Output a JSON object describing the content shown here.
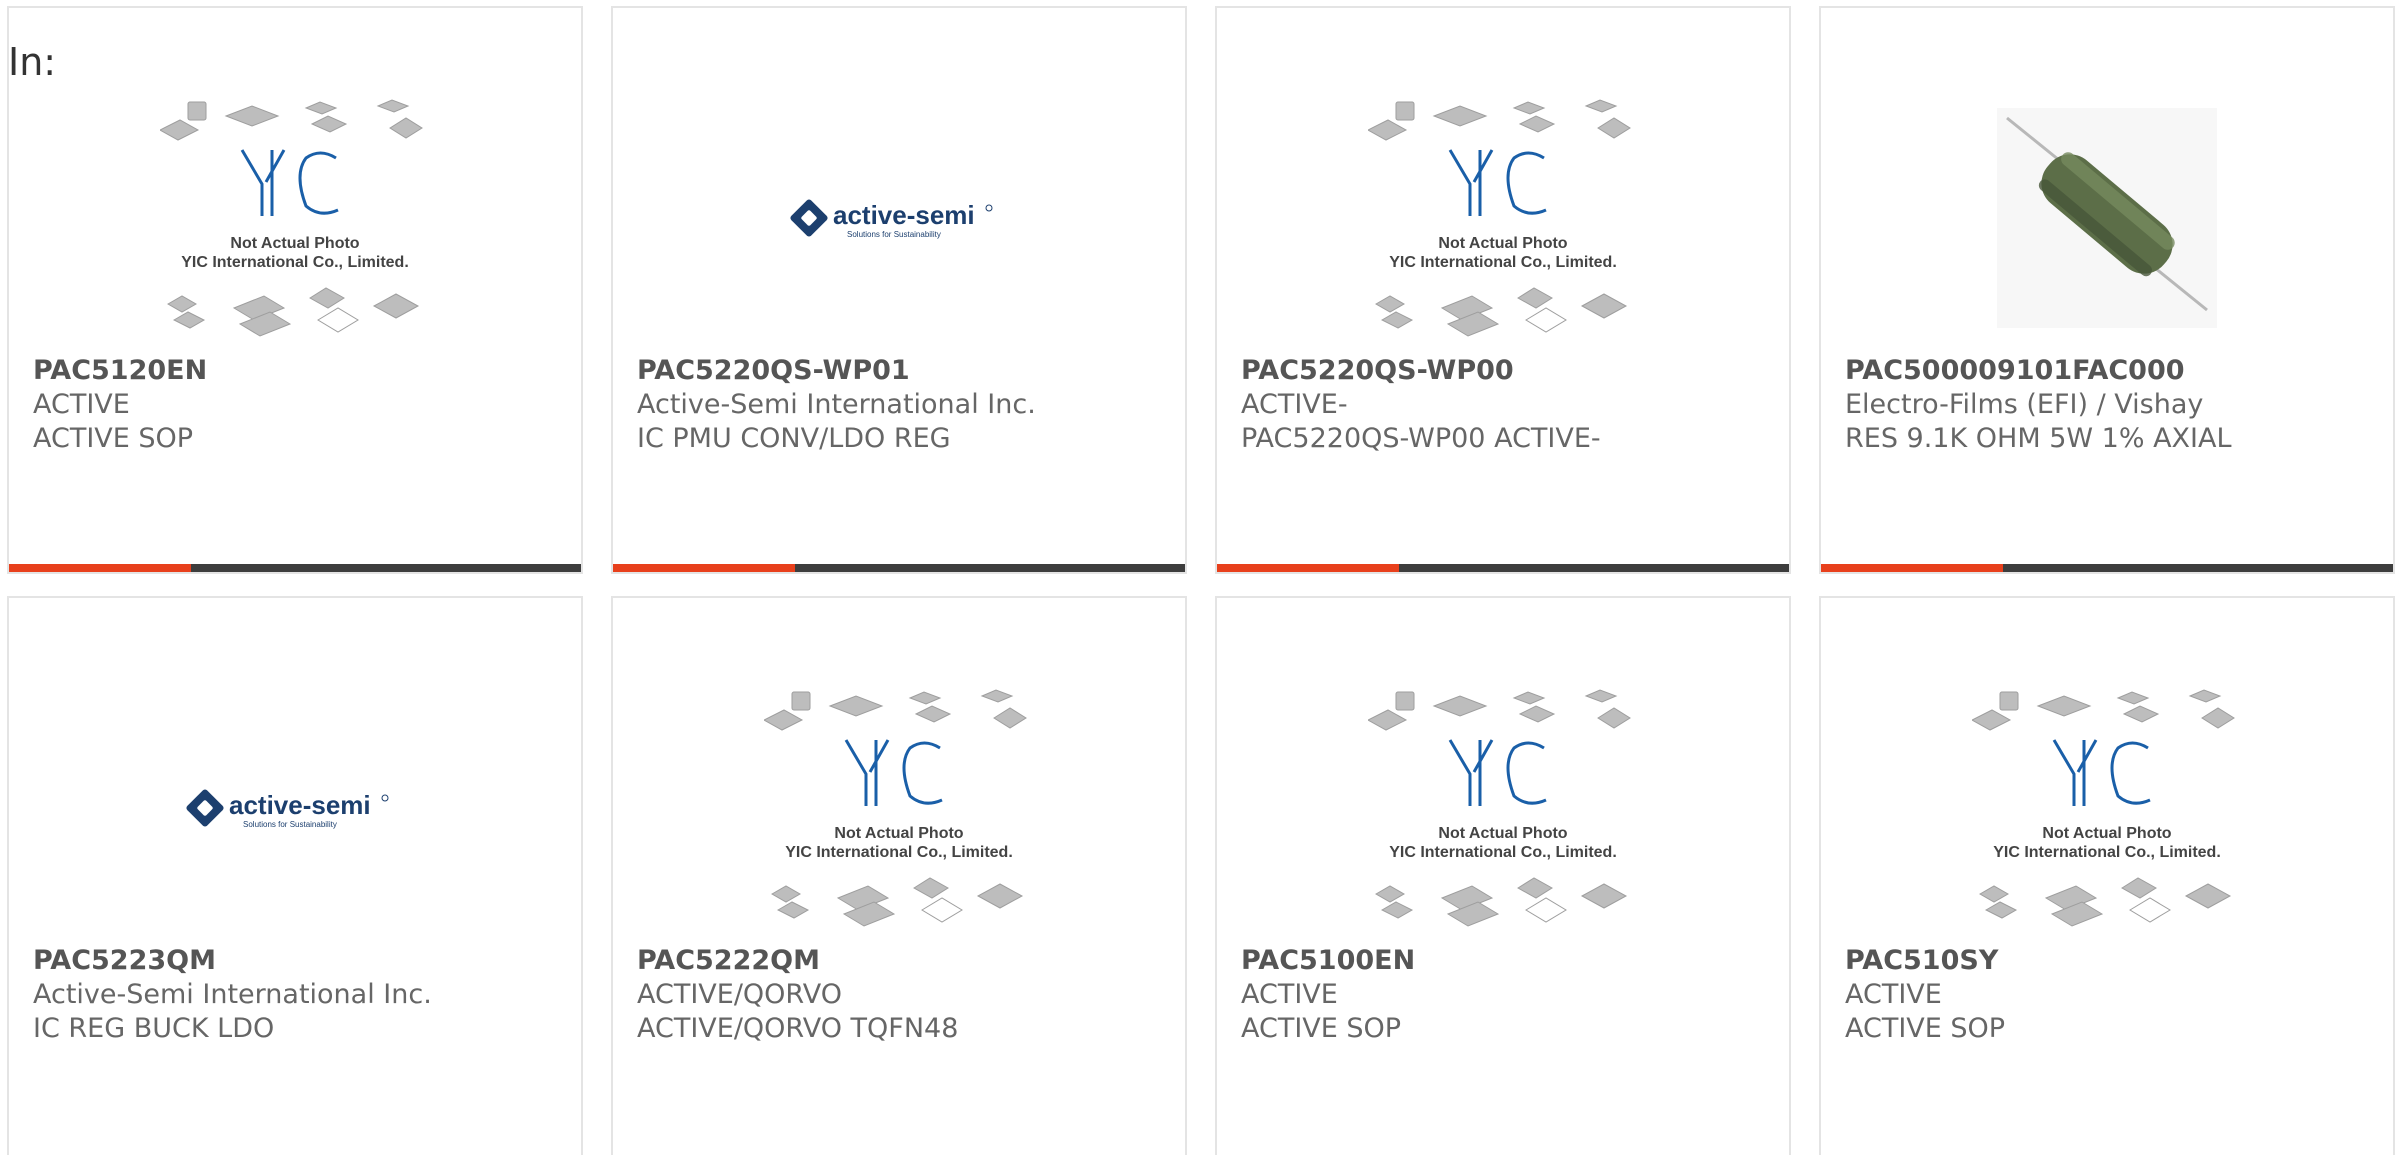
{
  "header": {
    "label": "In:"
  },
  "accent_color": "#e8401c",
  "bar_color": "#3d3d3d",
  "placeholder_caption": {
    "line1": "Not Actual Photo",
    "line2": "YIC International Co., Limited."
  },
  "brand_logo": {
    "text": "active-semi",
    "tagline": "Solutions for Sustainability"
  },
  "cards": [
    {
      "part_number": "PAC5120EN",
      "manufacturer": "ACTIVE",
      "description": "ACTIVE SOP",
      "image": "yic-placeholder"
    },
    {
      "part_number": "PAC5220QS-WP01",
      "manufacturer": "Active-Semi International Inc.",
      "description": "IC PMU CONV/LDO REG",
      "image": "active-semi-logo"
    },
    {
      "part_number": "PAC5220QS-WP00",
      "manufacturer": "ACTIVE-",
      "description": "PAC5220QS-WP00 ACTIVE-",
      "image": "yic-placeholder"
    },
    {
      "part_number": "PAC500009101FAC000",
      "manufacturer": "Electro-Films (EFI) / Vishay",
      "description": "RES 9.1K OHM 5W 1% AXIAL",
      "image": "axial-resistor"
    },
    {
      "part_number": "PAC5223QM",
      "manufacturer": "Active-Semi International Inc.",
      "description": "IC REG BUCK LDO",
      "image": "active-semi-logo"
    },
    {
      "part_number": "PAC5222QM",
      "manufacturer": "ACTIVE/QORVO",
      "description": "ACTIVE/QORVO TQFN48",
      "image": "yic-placeholder"
    },
    {
      "part_number": "PAC5100EN",
      "manufacturer": "ACTIVE",
      "description": "ACTIVE SOP",
      "image": "yic-placeholder"
    },
    {
      "part_number": "PAC510SY",
      "manufacturer": "ACTIVE",
      "description": "ACTIVE SOP",
      "image": "yic-placeholder"
    }
  ]
}
